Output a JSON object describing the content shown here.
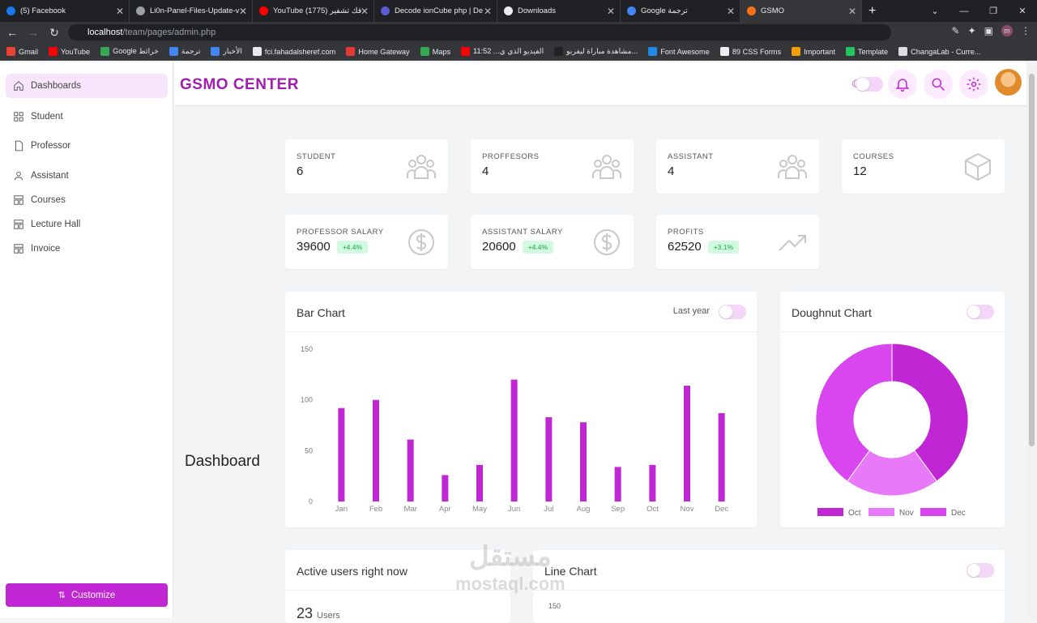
{
  "browser": {
    "tabs": [
      {
        "label": "(5) Facebook",
        "color": "#1877f2"
      },
      {
        "label": "Li0n-Panel-Files-Update-v",
        "color": "#9aa0a6"
      },
      {
        "label": "YouTube (1775) فك تشفير",
        "color": "#ff0000"
      },
      {
        "label": "Decode ionCube php | De",
        "color": "#5b5bd6"
      },
      {
        "label": "Downloads",
        "color": "#e8eaed"
      },
      {
        "label": "Google ترجمة",
        "color": "#4285f4"
      },
      {
        "label": "GSMO",
        "color": "#f97316",
        "active": true
      }
    ],
    "url_host": "localhost",
    "url_path": "/team/pages/admin.php",
    "bookmarks": [
      {
        "label": "Gmail",
        "color": "#ea4335"
      },
      {
        "label": "YouTube",
        "color": "#ff0000"
      },
      {
        "label": "Google خرائط",
        "color": "#34a853"
      },
      {
        "label": "ترجمة",
        "color": "#4285f4"
      },
      {
        "label": "الأخبار",
        "color": "#4285f4"
      },
      {
        "label": "fci.fahadalsheref.com",
        "color": "#e8eaed"
      },
      {
        "label": "Home Gateway",
        "color": "#e53935"
      },
      {
        "label": "Maps",
        "color": "#34a853"
      },
      {
        "label": "الفيديو الذي ي... 11:52",
        "color": "#ff0000"
      },
      {
        "label": "مشاهدة مباراة ليفربو...",
        "color": "#222"
      },
      {
        "label": "Font Awesome",
        "color": "#228ae6"
      },
      {
        "label": "89 CSS Forms",
        "color": "#eee"
      },
      {
        "label": "Important",
        "color": "#f59e0b"
      },
      {
        "label": "Template",
        "color": "#22c55e"
      },
      {
        "label": "ChangaLab - Curre...",
        "color": "#ddd"
      }
    ]
  },
  "sidebar": {
    "items": [
      {
        "label": "Dashboards",
        "icon": "home-icon",
        "active": true
      },
      {
        "label": "Student",
        "icon": "grid-icon"
      },
      {
        "label": "Professor",
        "icon": "file-icon"
      },
      {
        "label": "Assistant",
        "icon": "user-icon"
      },
      {
        "label": "Courses",
        "icon": "layout-icon"
      },
      {
        "label": "Lecture Hall",
        "icon": "layout-icon"
      },
      {
        "label": "Invoice",
        "icon": "layout-icon"
      }
    ],
    "customize_label": "Customize"
  },
  "header": {
    "brand": "GSMO CENTER"
  },
  "page_title": "Dashboard",
  "stats": [
    {
      "label": "STUDENT",
      "value": "6",
      "icon": "users-icon"
    },
    {
      "label": "PROFFESORS",
      "value": "4",
      "icon": "users-icon"
    },
    {
      "label": "ASSISTANT",
      "value": "4",
      "icon": "users-icon"
    },
    {
      "label": "COURSES",
      "value": "12",
      "icon": "box-icon"
    },
    {
      "label": "PROFESSOR SALARY",
      "value": "39600",
      "badge": "+4.4%",
      "icon": "dollar-icon"
    },
    {
      "label": "ASSISTANT SALARY",
      "value": "20600",
      "badge": "+4.4%",
      "icon": "dollar-icon"
    },
    {
      "label": "PROFITS",
      "value": "62520",
      "badge": "+3.1%",
      "icon": "trending-up-icon"
    }
  ],
  "bar_card": {
    "title": "Bar Chart",
    "toggle_label": "Last year"
  },
  "doughnut_card": {
    "title": "Doughnut Chart"
  },
  "active_card": {
    "title": "Active users right now",
    "value": "23",
    "unit": "Users"
  },
  "line_card": {
    "title": "Line Chart",
    "first_tick": "150"
  },
  "watermark": {
    "line1": "مستقل",
    "line2": "mostaql.com"
  },
  "chart_data": [
    {
      "type": "bar",
      "title": "Bar Chart",
      "categories": [
        "Jan",
        "Feb",
        "Mar",
        "Apr",
        "May",
        "Jun",
        "Jul",
        "Aug",
        "Sep",
        "Oct",
        "Nov",
        "Dec"
      ],
      "values": [
        92,
        100,
        61,
        26,
        36,
        120,
        83,
        78,
        34,
        36,
        114,
        87
      ],
      "ylim": [
        0,
        150
      ],
      "yticks": [
        0,
        50,
        100,
        150
      ],
      "color": "#c026d3"
    },
    {
      "type": "pie",
      "title": "Doughnut Chart",
      "categories": [
        "Oct",
        "Nov",
        "Dec"
      ],
      "values": [
        40,
        20,
        40
      ],
      "colors": [
        "#c026d3",
        "#e879f9",
        "#d946ef"
      ]
    }
  ]
}
